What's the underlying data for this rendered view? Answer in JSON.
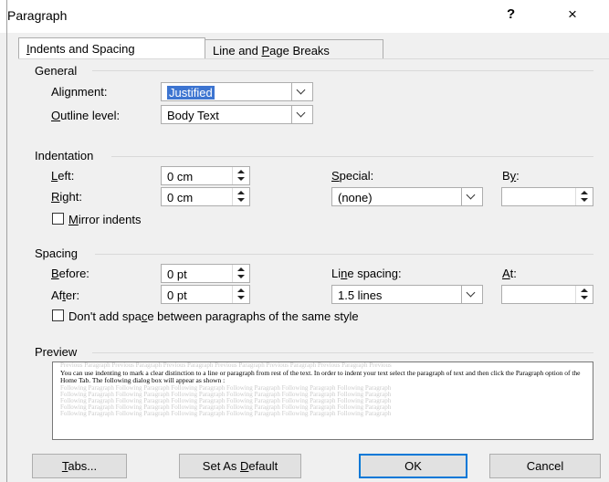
{
  "dialog": {
    "title": "Paragraph",
    "help": "?",
    "close": "×"
  },
  "tabs": [
    {
      "pre": "",
      "u": "I",
      "post": "ndents and Spacing"
    },
    {
      "pre": "Line and ",
      "u": "P",
      "post": "age Breaks"
    }
  ],
  "general": {
    "section": "General",
    "alignment_pre": "Ali",
    "alignment_u": "g",
    "alignment_post": "nment:",
    "alignment_value": "Justified",
    "outline_pre": "",
    "outline_u": "O",
    "outline_post": "utline level:",
    "outline_value": "Body Text"
  },
  "indentation": {
    "section": "Indentation",
    "left_pre": "",
    "left_u": "L",
    "left_post": "eft:",
    "left_value": "0 cm",
    "right_pre": "",
    "right_u": "R",
    "right_post": "ight:",
    "right_value": "0 cm",
    "special_pre": "",
    "special_u": "S",
    "special_post": "pecial:",
    "special_value": "(none)",
    "by_pre": "B",
    "by_u": "y",
    "by_post": ":",
    "mirror_pre": "",
    "mirror_u": "M",
    "mirror_post": "irror indents"
  },
  "spacing": {
    "section": "Spacing",
    "before_pre": "",
    "before_u": "B",
    "before_post": "efore:",
    "before_value": "0 pt",
    "after_pre": "Af",
    "after_u": "t",
    "after_post": "er:",
    "after_value": "0 pt",
    "line_pre": "Li",
    "line_u": "n",
    "line_post": "e spacing:",
    "line_value": "1.5 lines",
    "at_pre": "",
    "at_u": "A",
    "at_post": "t:",
    "dont_pre": "Don't add spa",
    "dont_u": "c",
    "dont_post": "e between paragraphs of the same style"
  },
  "preview": {
    "section": "Preview",
    "before_line": "Previous Paragraph Previous Paragraph Previous Paragraph Previous Paragraph Previous Paragraph Previous Paragraph Previous",
    "text": "You can use indenting to mark a clear distinction to a line or paragraph from rest of the text. In order to indent your text select the paragraph of text and then click the Paragraph option of the Home Tab. The following dialog box will appear as shown :",
    "after_line": "Following Paragraph Following Paragraph Following Paragraph Following Paragraph Following Paragraph Following Paragraph"
  },
  "buttons": {
    "tabs_pre": "",
    "tabs_u": "T",
    "tabs_post": "abs...",
    "default_pre": "Set As ",
    "default_u": "D",
    "default_post": "efault",
    "ok": "OK",
    "cancel": "Cancel"
  }
}
